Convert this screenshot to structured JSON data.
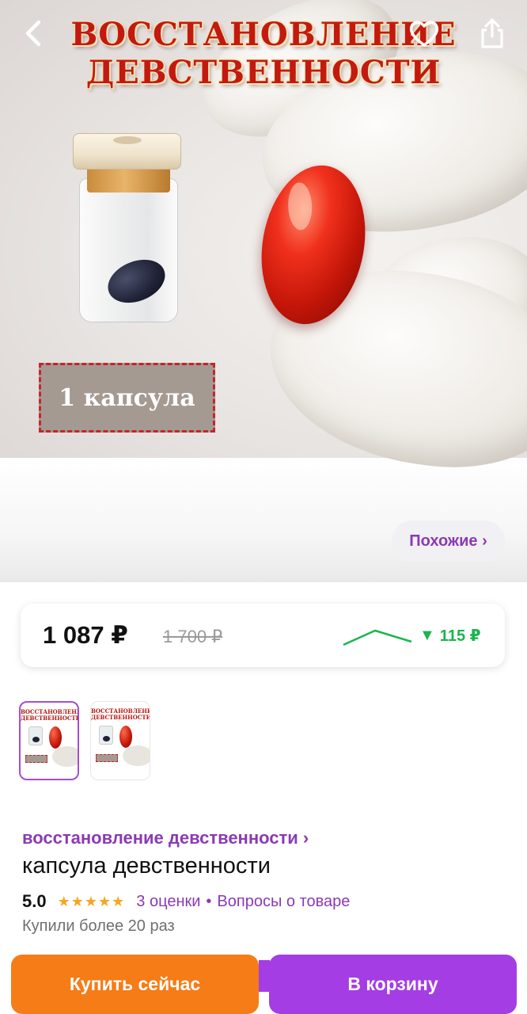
{
  "hero": {
    "title_line1": "ВОССТАНОВЛЕНИЕ",
    "title_line2": "ДЕВСТВЕННОСТИ",
    "badge_text": "1 капсула"
  },
  "toolbar": {
    "back_icon": "chevron-left-icon",
    "favorite_icon": "heart-icon",
    "share_icon": "share-icon"
  },
  "similar": {
    "label": "Похожие ›"
  },
  "price": {
    "current": "1 087 ₽",
    "old": "1 700 ₽",
    "drop_arrow": "▼",
    "drop": "115 ₽",
    "trend_color": "#19b54d"
  },
  "thumbnails": [
    {
      "title": "ВОССТАНОВЛЕНИЕ ДЕВСТВЕННОСТИ",
      "active": true
    },
    {
      "title": "ВОССТАНОВЛЕНИЕ ДЕВСТВЕННОСТИ",
      "active": false
    }
  ],
  "product": {
    "category_link": "восстановление девственности ›",
    "title": "капсула девственности",
    "rating": "5.0",
    "stars": "★★★★★",
    "reviews_link": "3 оценки",
    "separator": "•",
    "questions_link": "Вопросы о товаре",
    "bought": "Купили более 20 раз"
  },
  "actions": {
    "buy_now": "Купить сейчас",
    "add_to_cart": "В корзину"
  },
  "colors": {
    "accent_purple": "#8b3ab4",
    "buy_orange": "#f57c16",
    "cart_purple": "#a43de3",
    "title_red": "#c21a10"
  }
}
